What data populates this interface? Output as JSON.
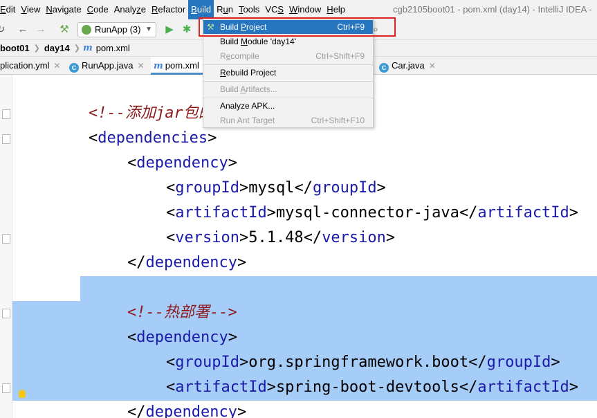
{
  "menubar": {
    "items": [
      {
        "pre": "",
        "mn": "E",
        "post": "dit"
      },
      {
        "pre": "",
        "mn": "V",
        "post": "iew"
      },
      {
        "pre": "",
        "mn": "N",
        "post": "avigate"
      },
      {
        "pre": "",
        "mn": "C",
        "post": "ode"
      },
      {
        "pre": "Analy",
        "mn": "z",
        "post": "e"
      },
      {
        "pre": "",
        "mn": "R",
        "post": "efactor"
      },
      {
        "pre": "",
        "mn": "B",
        "post": "uild"
      },
      {
        "pre": "R",
        "mn": "u",
        "post": "n"
      },
      {
        "pre": "",
        "mn": "T",
        "post": "ools"
      },
      {
        "pre": "VC",
        "mn": "S",
        "post": ""
      },
      {
        "pre": "",
        "mn": "W",
        "post": "indow"
      },
      {
        "pre": "",
        "mn": "H",
        "post": "elp"
      }
    ],
    "window_title": "cgb2105boot01 - pom.xml (day14) - IntelliJ IDEA -"
  },
  "toolbar": {
    "run_config": "RunApp (3)"
  },
  "breadcrumb": {
    "items": [
      "boot01",
      "day14",
      "pom.xml"
    ]
  },
  "tabs": [
    {
      "label": "plication.yml"
    },
    {
      "label": "RunApp.java"
    },
    {
      "label": "pom.xml"
    },
    {
      "label": "Car.java"
    }
  ],
  "build_menu": {
    "items": [
      {
        "pre": "Build ",
        "mn": "P",
        "post": "roject",
        "shortcut": "Ctrl+F9",
        "enabled": true,
        "highlighted": true
      },
      {
        "pre": "Build ",
        "mn": "M",
        "post": "odule 'day14'",
        "shortcut": "",
        "enabled": true,
        "highlighted": false
      },
      {
        "pre": "R",
        "mn": "e",
        "post": "compile",
        "shortcut": "Ctrl+Shift+F9",
        "enabled": false,
        "highlighted": false
      },
      {
        "pre": "",
        "mn": "R",
        "post": "ebuild Project",
        "shortcut": "",
        "enabled": true,
        "highlighted": false
      },
      {
        "pre": "Build ",
        "mn": "A",
        "post": "rtifacts...",
        "shortcut": "",
        "enabled": false,
        "highlighted": false
      },
      {
        "pre": "Analyze APK...",
        "mn": "",
        "post": "",
        "shortcut": "",
        "enabled": true,
        "highlighted": false
      },
      {
        "pre": "Run Ant Target",
        "mn": "",
        "post": "",
        "shortcut": "Ctrl+Shift+F10",
        "enabled": false,
        "highlighted": false
      }
    ]
  },
  "editor": {
    "lines": [
      {
        "cmt_open": "<!--",
        "cmt_text": "添加jar包的依",
        "cmt_close": ""
      },
      {
        "open": "<",
        "name": "dependencies",
        "close": ">"
      },
      {
        "open": "<",
        "name": "dependency",
        "close": ">"
      },
      {
        "open": "<",
        "name": "groupId",
        "close": ">",
        "value": "mysql",
        "eopen": "</",
        "ename": "groupId",
        "eclose": ">"
      },
      {
        "open": "<",
        "name": "artifactId",
        "close": ">",
        "value": "mysql-connector-java",
        "eopen": "</",
        "ename": "artifactId",
        "eclose": ">"
      },
      {
        "open": "<",
        "name": "version",
        "close": ">",
        "value": "5.1.48",
        "eopen": "</",
        "ename": "version",
        "eclose": ">"
      },
      {
        "open": "</",
        "name": "dependency",
        "close": ">"
      },
      {
        "cmt_open": "<!--",
        "cmt_text": "热部署",
        "cmt_close": "-->"
      },
      {
        "open": "<",
        "name": "dependency",
        "close": ">"
      },
      {
        "open": "<",
        "name": "groupId",
        "close": ">",
        "value": "org.springframework.boot",
        "eopen": "</",
        "ename": "groupId",
        "eclose": ">"
      },
      {
        "open": "<",
        "name": "artifactId",
        "close": ">",
        "value": "spring-boot-devtools",
        "eopen": "</",
        "ename": "artifactId",
        "eclose": ">"
      },
      {
        "open": "</",
        "name": "dependency",
        "close": ">"
      }
    ]
  },
  "colors": {
    "menu_highlight": "#2675bf",
    "selection": "#a6cdf7",
    "tag": "#1b1ba8",
    "comment": "#8c1a1a",
    "callout_border": "#e02424"
  }
}
